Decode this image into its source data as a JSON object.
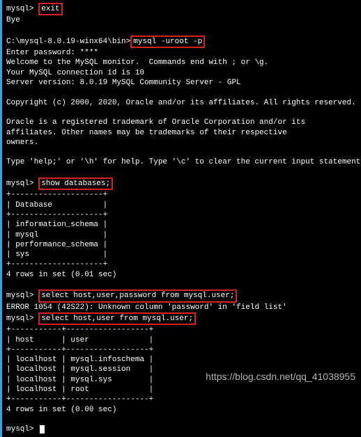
{
  "prompt_exit": {
    "prefix": "mysql> ",
    "cmd": "exit"
  },
  "bye": "Bye",
  "login_line": {
    "prefix": "C:\\mysql-8.0.19-winx64\\bin>",
    "cmd": "mysql -uroot -p"
  },
  "password_line": "Enter password: ****",
  "welcome1": "Welcome to the MySQL monitor.  Commands end with ; or \\g.",
  "welcome2": "Your MySQL connection id is 10",
  "welcome3": "Server version: 8.0.19 MySQL Community Server - GPL",
  "copyright": "Copyright (c) 2000, 2020, Oracle and/or its affiliates. All rights reserved.",
  "trademark1": "Oracle is a registered trademark of Oracle Corporation and/or its",
  "trademark2": "affiliates. Other names may be trademarks of their respective",
  "trademark3": "owners.",
  "help": "Type 'help;' or '\\h' for help. Type '\\c' to clear the current input statement.",
  "show_db": {
    "prefix": "mysql> ",
    "cmd": "show databases;"
  },
  "db_border": "+--------------------+",
  "db_header": "| Database           |",
  "db_rows": [
    "| information_schema |",
    "| mysql              |",
    "| performance_schema |",
    "| sys                |"
  ],
  "rows_result1": "4 rows in set (0.01 sec)",
  "select1": {
    "prefix": "mysql> ",
    "cmd": "select host,user,password from mysql.user;"
  },
  "error_line": "ERROR 1054 (42S22): Unknown column 'password' in 'field list'",
  "select2": {
    "prefix": "mysql> ",
    "cmd": "select host,user from mysql.user;"
  },
  "user_border": "+-----------+------------------+",
  "user_header": "| host      | user             |",
  "user_rows": [
    "| localhost | mysql.infoschema |",
    "| localhost | mysql.session    |",
    "| localhost | mysql.sys        |",
    "| localhost | root             |"
  ],
  "rows_result2": "4 rows in set (0.00 sec)",
  "final_prompt": "mysql> ",
  "watermark": "https://blog.csdn.net/qq_41038955"
}
